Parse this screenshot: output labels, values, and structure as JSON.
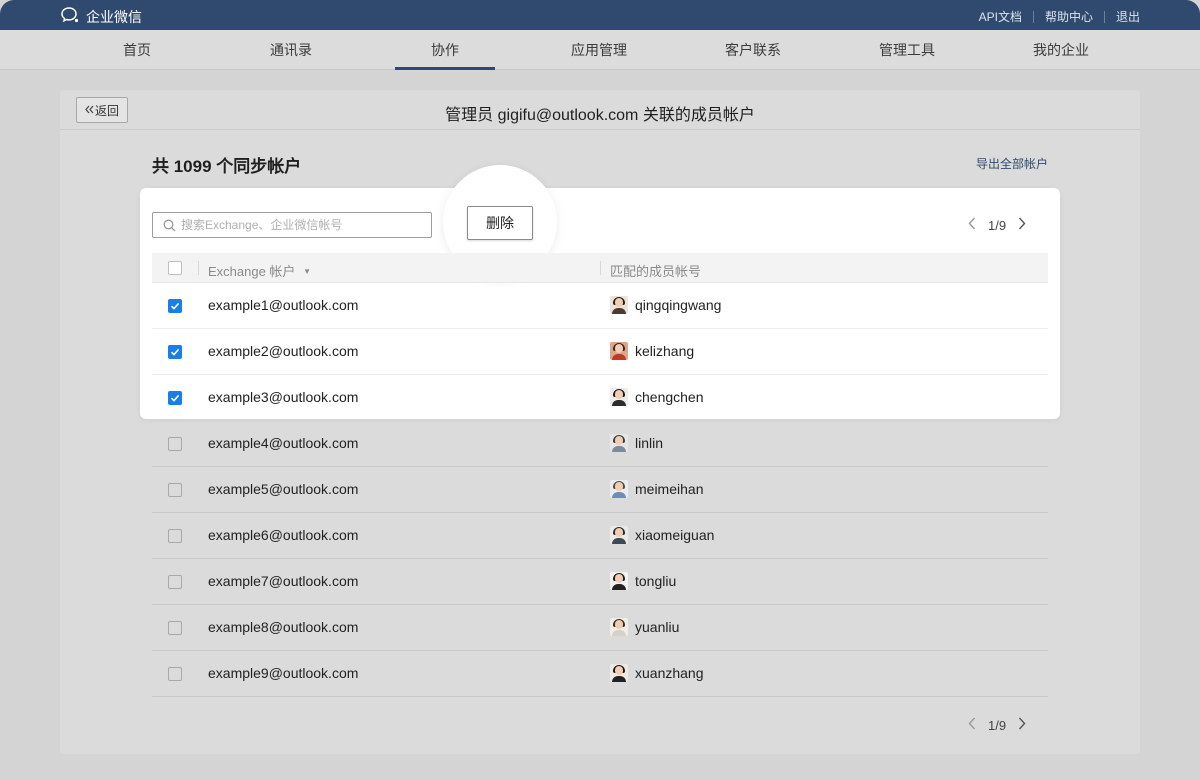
{
  "topbar": {
    "brand": "企业微信",
    "links": [
      "API文档",
      "帮助中心",
      "退出"
    ]
  },
  "nav": {
    "tabs": [
      "首页",
      "通讯录",
      "协作",
      "应用管理",
      "客户联系",
      "管理工具",
      "我的企业"
    ],
    "active": "协作"
  },
  "panel": {
    "back_label": "返回",
    "title": "管理员 gigifu@outlook.com 关联的成员帐户",
    "count_label": "共 1099 个同步帐户",
    "export_label": "导出全部帐户"
  },
  "toolbar": {
    "search_placeholder": "搜索Exchange、企业微信帐号",
    "delete_label": "删除",
    "pager_top": "1/9",
    "pager_bottom": "1/9"
  },
  "table": {
    "col_exchange": "Exchange 帐户",
    "col_member": "匹配的成员帐号",
    "sort_indicator": "▼",
    "rows": [
      {
        "email": "example1@outlook.com",
        "member": "qingqingwang",
        "checked": true
      },
      {
        "email": "example2@outlook.com",
        "member": "kelizhang",
        "checked": true
      },
      {
        "email": "example3@outlook.com",
        "member": "chengchen",
        "checked": true
      },
      {
        "email": "example4@outlook.com",
        "member": "linlin",
        "checked": false
      },
      {
        "email": "example5@outlook.com",
        "member": "meimeihan",
        "checked": false
      },
      {
        "email": "example6@outlook.com",
        "member": "xiaomeiguan",
        "checked": false
      },
      {
        "email": "example7@outlook.com",
        "member": "tongliu",
        "checked": false
      },
      {
        "email": "example8@outlook.com",
        "member": "yuanliu",
        "checked": false
      },
      {
        "email": "example9@outlook.com",
        "member": "xuanzhang",
        "checked": false
      }
    ]
  },
  "colors": {
    "topbar": "#2f4a6e",
    "accent": "#2f4a6e",
    "checkbox_checked": "#1a7ee8"
  },
  "icons": [
    "wecom-logo-icon",
    "double-chevron-left-icon",
    "search-icon",
    "chevron-left-icon",
    "chevron-right-icon",
    "checkmark-icon",
    "avatar-icon"
  ]
}
